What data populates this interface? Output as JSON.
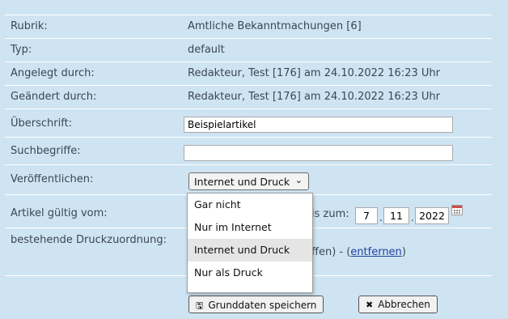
{
  "rows": {
    "rubrik": {
      "label": "Rubrik:",
      "value": "Amtliche Bekanntmachungen [6]"
    },
    "typ": {
      "label": "Typ:",
      "value": "default"
    },
    "angelegt": {
      "label": "Angelegt durch:",
      "value": "Redakteur, Test [176] am 24.10.2022 16:23 Uhr"
    },
    "geaendert": {
      "label": "Geändert durch:",
      "value": "Redakteur, Test [176] am 24.10.2022 16:23 Uhr"
    },
    "ueberschrift": {
      "label": "Überschrift:",
      "input_value": "Beispielartikel"
    },
    "suchbegriffe": {
      "label": "Suchbegriffe:",
      "input_value": ""
    },
    "veroeffentlichen": {
      "label": "Veröffentlichen:",
      "selected": "Internet und Druck"
    },
    "gueltig": {
      "label": "Artikel gültig vom:",
      "bis_label": "is zum:",
      "day": "7",
      "month": "11",
      "year": "2022"
    },
    "druck": {
      "label": "bestehende Druckzuordnung:",
      "partial_text": "ffen) - (",
      "remove_link": "entfernen",
      "close_paren": ")"
    }
  },
  "dropdown": {
    "options": [
      "Gar nicht",
      "Nur im Internet",
      "Internet und Druck",
      "Nur als Druck"
    ],
    "highlighted_index": 2
  },
  "buttons": {
    "save": {
      "label": "Grunddaten speichern",
      "icon": "save-icon"
    },
    "cancel": {
      "label": "Abbrechen",
      "icon": "close-icon"
    }
  },
  "colors": {
    "panel_bg": "#cfe4f3",
    "row_separator": "#ffffff",
    "link": "#1f3fa0"
  }
}
